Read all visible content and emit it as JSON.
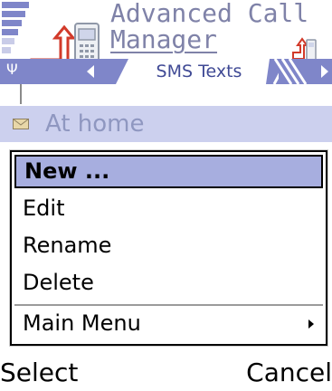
{
  "header": {
    "title_line1": "Advanced Call",
    "title_line2": "Manager"
  },
  "tabs": {
    "active_label": "SMS Texts"
  },
  "list": {
    "item_label": "At home"
  },
  "menu": {
    "items": [
      {
        "label": "New ..."
      },
      {
        "label": "Edit"
      },
      {
        "label": "Rename"
      },
      {
        "label": "Delete"
      },
      {
        "label": "Main Menu"
      }
    ]
  },
  "softkeys": {
    "left": "Select",
    "right": "Cancel"
  },
  "colors": {
    "accent": "#7f86c9",
    "selection": "#a7aedf",
    "list_highlight": "#ccd0ee"
  }
}
